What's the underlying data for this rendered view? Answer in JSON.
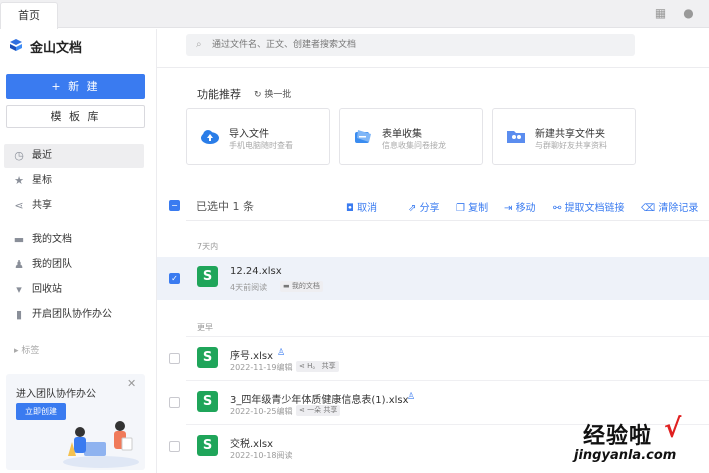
{
  "tabs": {
    "home": "首页"
  },
  "sidebar": {
    "brand": "金山文档",
    "new_button": "+ 新 建",
    "template_button": "模 板 库",
    "items": [
      {
        "label": "最近",
        "icon": "clock-icon"
      },
      {
        "label": "星标",
        "icon": "star-icon"
      },
      {
        "label": "共享",
        "icon": "share-icon"
      },
      {
        "label": "我的文档",
        "icon": "folder-icon"
      },
      {
        "label": "我的团队",
        "icon": "team-icon"
      },
      {
        "label": "回收站",
        "icon": "trash-icon"
      },
      {
        "label": "开启团队协作办公",
        "icon": "collab-icon"
      }
    ],
    "tags_label": "▸ 标签",
    "promo": {
      "title": "进入团队协作办公",
      "button": "立即创建"
    }
  },
  "search": {
    "placeholder": "通过文件名、正文、创建者搜索文档"
  },
  "recommend": {
    "title": "功能推荐",
    "refresh": "换一批",
    "cards": [
      {
        "title": "导入文件",
        "sub": "手机电脑随时查看",
        "icon": "cloud-upload-icon"
      },
      {
        "title": "表单收集",
        "sub": "信息收集问卷接龙",
        "icon": "form-icon"
      },
      {
        "title": "新建共享文件夹",
        "sub": "与群聊好友共享资料",
        "icon": "shared-folder-icon"
      }
    ]
  },
  "selection": {
    "text": "已选中 1 条",
    "actions": [
      "取消",
      "分享",
      "复制",
      "移动",
      "提取文档链接",
      "清除记录"
    ]
  },
  "groups": {
    "recent": "7天内",
    "earlier": "更早"
  },
  "files": [
    {
      "name": "12.24.xlsx",
      "meta": "4天前阅读",
      "tag": "我的文档",
      "selected": true
    },
    {
      "name": "序号.xlsx",
      "meta": "2022-11-19编辑",
      "tag": "H。 共享",
      "selected": false
    },
    {
      "name": "3_四年级青少年体质健康信息表(1).xlsx",
      "meta": "2022-10-25编辑",
      "tag": "一朵 共享",
      "selected": false
    },
    {
      "name": "交税.xlsx",
      "meta": "2022-10-18阅读",
      "tag": "",
      "selected": false
    }
  ],
  "watermark": {
    "main": "经验啦",
    "check": "√",
    "sub": "jingyanla.com"
  },
  "colors": {
    "accent": "#3a7bf0",
    "excel": "#1fa55a"
  }
}
